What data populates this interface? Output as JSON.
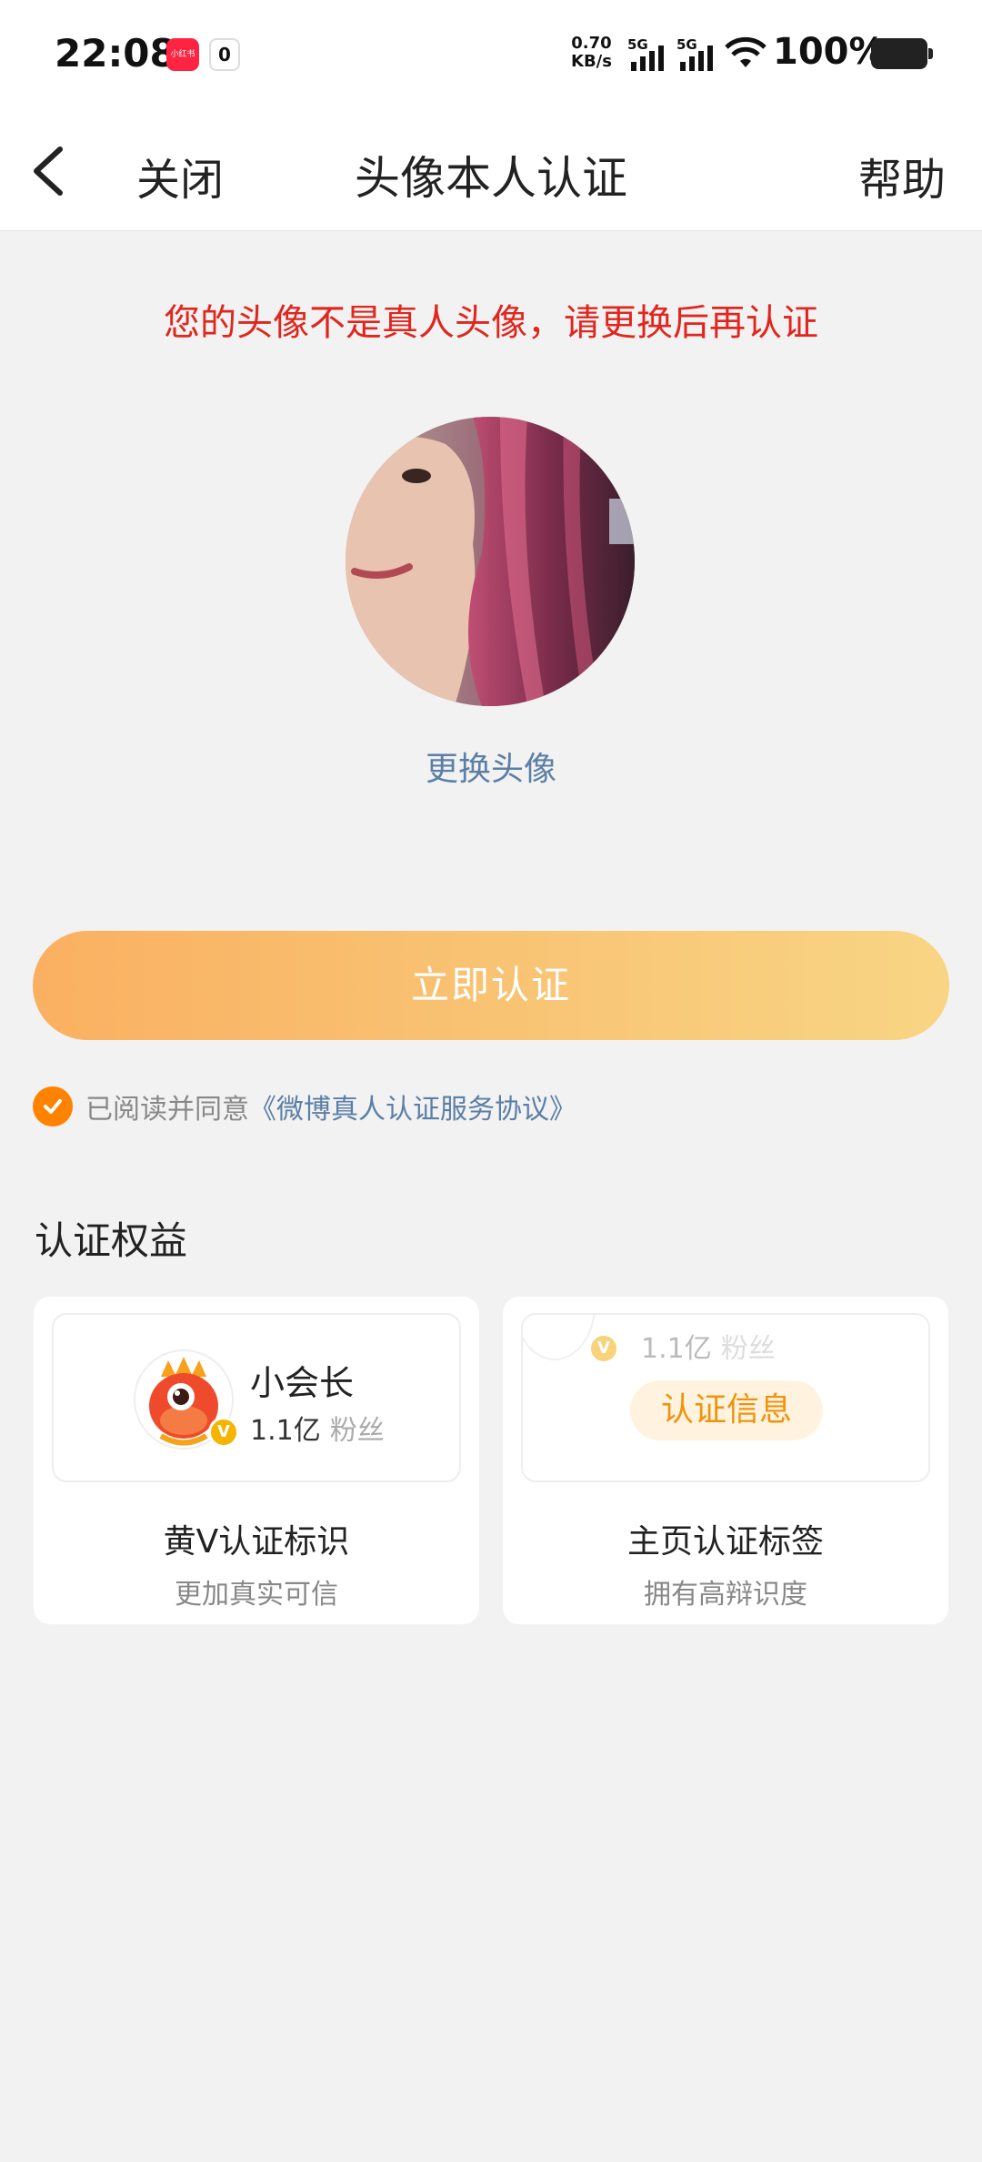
{
  "status_bar": {
    "time": "22:08",
    "app_icon_text": "小红书",
    "network_speed_value": "0.70",
    "network_speed_unit": "KB/s",
    "signal1_label": "5G",
    "signal2_label": "5G",
    "battery": "100%"
  },
  "nav": {
    "back_icon": "chevron-left-icon",
    "close_label": "关闭",
    "title": "头像本人认证",
    "help_label": "帮助"
  },
  "warning_text": "您的头像不是真人头像，请更换后再认证",
  "change_avatar_label": "更换头像",
  "verify_button_label": "立即认证",
  "agreement": {
    "checked": true,
    "prefix": "已阅读并同意",
    "link": "《微博真人认证服务协议》"
  },
  "benefits": {
    "title": "认证权益",
    "cards": [
      {
        "demo_name": "小会长",
        "demo_fans_count": "1.1亿",
        "demo_fans_label": "粉丝",
        "name": "黄V认证标识",
        "desc": "更加真实可信"
      },
      {
        "demo_fans_count": "1.1亿",
        "demo_fans_label": "粉丝",
        "demo_tag": "认证信息",
        "name": "主页认证标签",
        "desc": "拥有高辩识度"
      }
    ]
  },
  "colors": {
    "warning": "#e0261d",
    "link": "#5b7fa6",
    "accent_orange": "#ff8200",
    "button_gradient_start": "#fab061",
    "button_gradient_end": "#f8d584",
    "v_badge": "#f5b400"
  }
}
